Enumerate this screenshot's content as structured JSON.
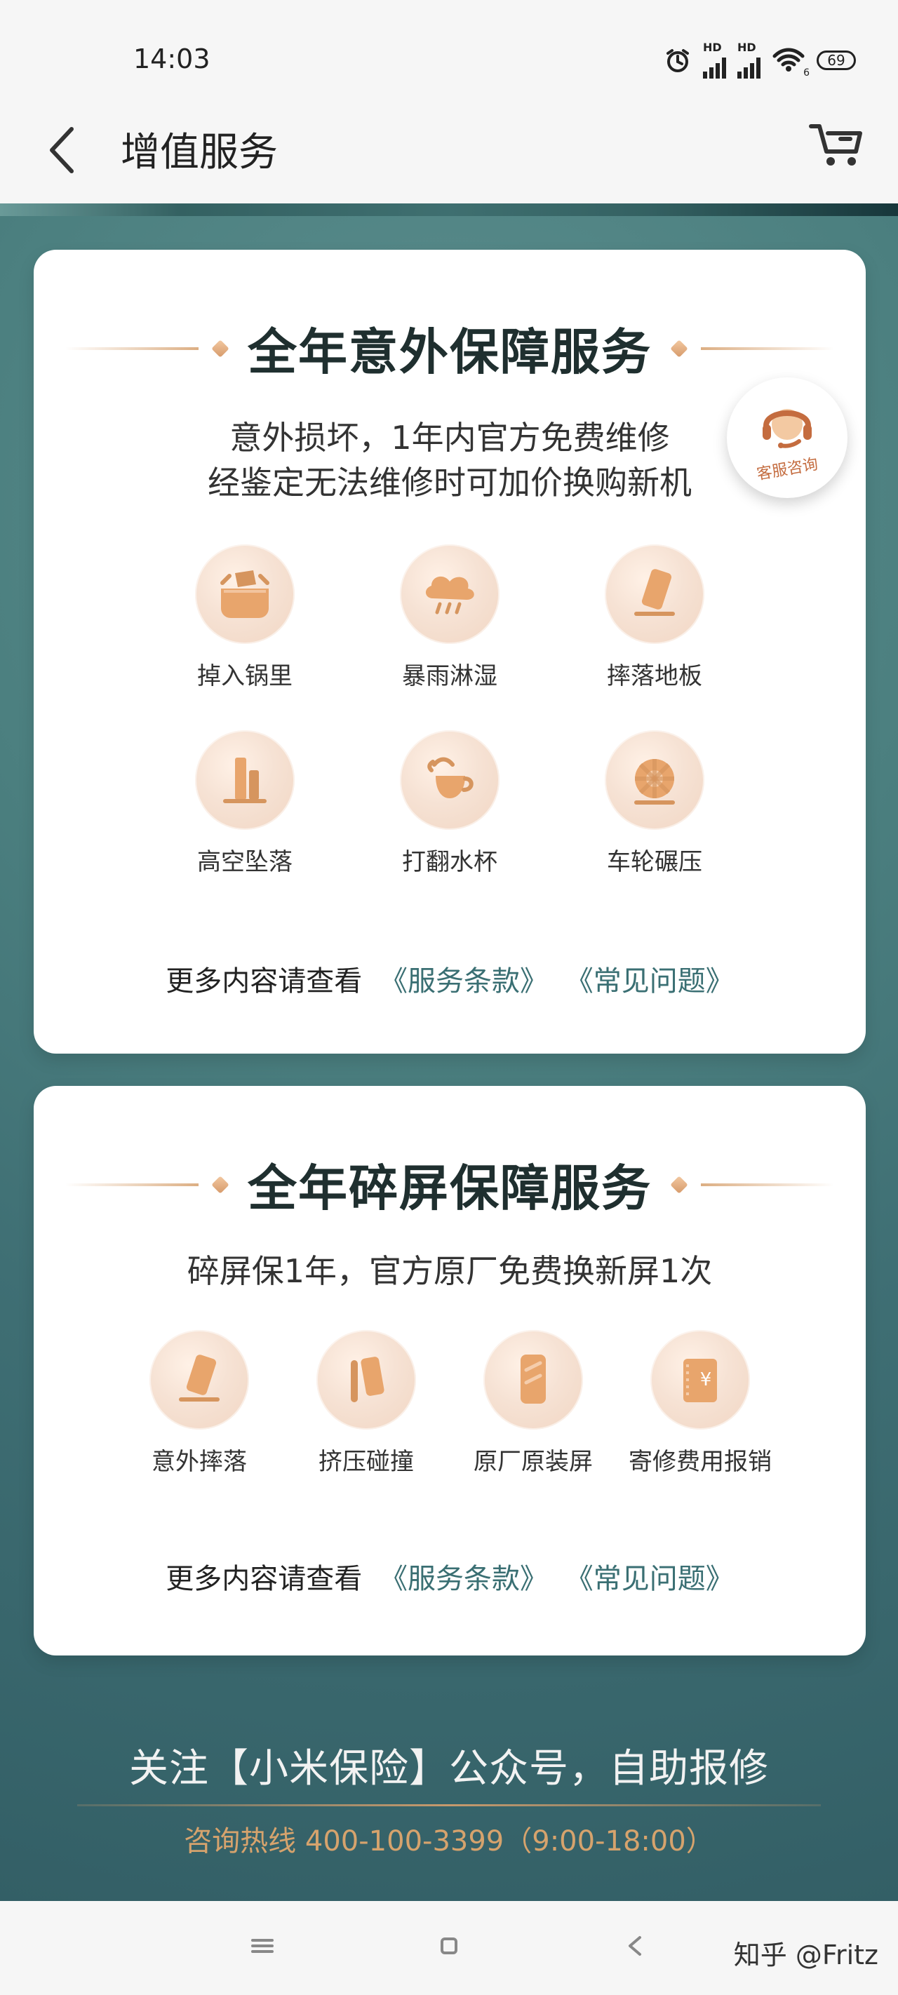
{
  "status": {
    "time": "14:03",
    "signal_label_1": "HD",
    "signal_label_2": "HD",
    "wifi_badge": "6",
    "battery": "69"
  },
  "header": {
    "title": "增值服务"
  },
  "card_accident": {
    "title": "全年意外保障服务",
    "subtitle_line1": "意外损坏，1年内官方免费维修",
    "subtitle_line2": "经鉴定无法维修时可加价换购新机",
    "support_badge": "客服咨询",
    "features": [
      {
        "label": "掉入锅里",
        "icon": "pot-icon"
      },
      {
        "label": "暴雨淋湿",
        "icon": "rain-cloud-icon"
      },
      {
        "label": "摔落地板",
        "icon": "phone-drop-icon"
      },
      {
        "label": "高空坠落",
        "icon": "high-fall-icon"
      },
      {
        "label": "打翻水杯",
        "icon": "spilled-cup-icon"
      },
      {
        "label": "车轮碾压",
        "icon": "wheel-icon"
      }
    ],
    "more_prefix": "更多内容请查看",
    "link_terms": "《服务条款》",
    "link_faq": "《常见问题》"
  },
  "card_screen": {
    "title": "全年碎屏保障服务",
    "subtitle": "碎屏保1年，官方原厂免费换新屏1次",
    "features": [
      {
        "label": "意外摔落",
        "icon": "phone-drop-icon"
      },
      {
        "label": "挤压碰撞",
        "icon": "squeeze-icon"
      },
      {
        "label": "原厂原装屏",
        "icon": "screen-icon"
      },
      {
        "label": "寄修费用报销",
        "icon": "receipt-yen-icon"
      }
    ],
    "more_prefix": "更多内容请查看",
    "link_terms": "《服务条款》",
    "link_faq": "《常见问题》"
  },
  "footer": {
    "follow_text": "关注【小米保险】公众号，自助报修",
    "hotline": "咨询热线 400-100-3399（9:00-18:00）"
  },
  "watermark": "知乎 @Fritz"
}
